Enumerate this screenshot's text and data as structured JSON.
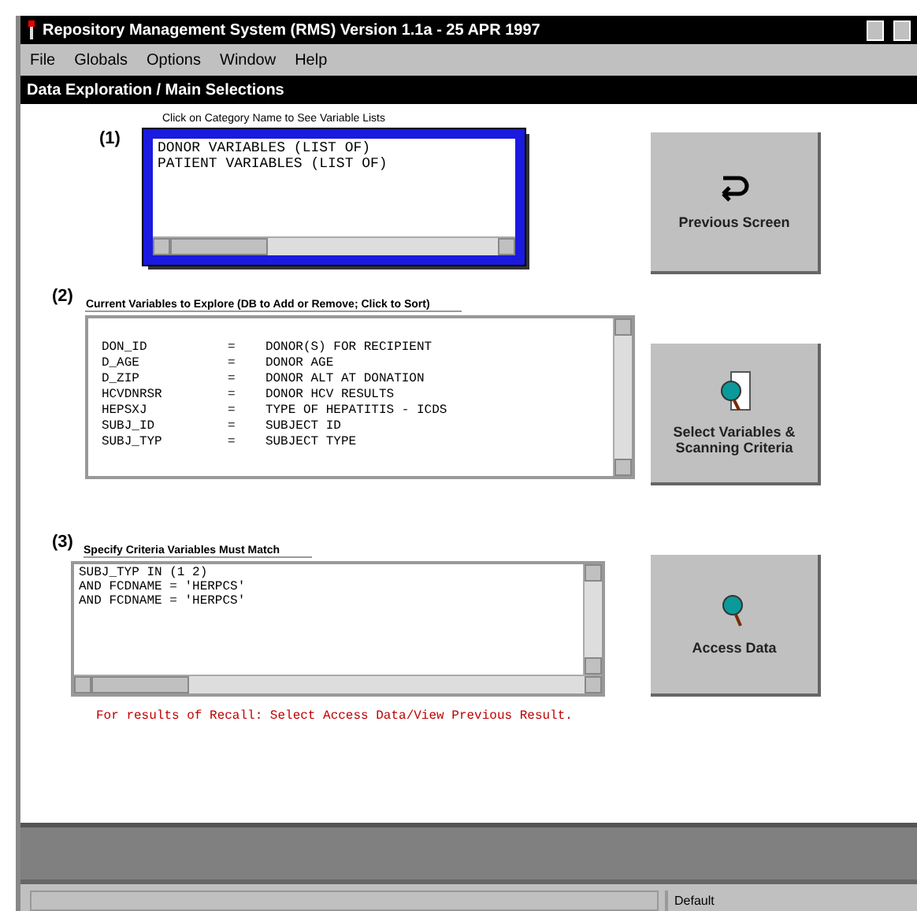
{
  "window": {
    "title": "Repository Management System (RMS) Version 1.1a - 25 APR 1997"
  },
  "menu": [
    "File",
    "Globals",
    "Options",
    "Window",
    "Help"
  ],
  "screen_title": "Data Exploration / Main Selections",
  "categories": {
    "hint": "Click on Category Name to See Variable Lists",
    "marker": "(1)",
    "items": [
      "DONOR VARIABLES (LIST OF)",
      "PATIENT VARIABLES (LIST OF)"
    ]
  },
  "variables": {
    "marker": "(2)",
    "label": "Current Variables to Explore (DB to Add or Remove; Click to Sort)",
    "rows": [
      {
        "name": "DON_ID",
        "sep": "=",
        "description": "DONOR(S) FOR RECIPIENT"
      },
      {
        "name": "D_AGE",
        "sep": "=",
        "description": "DONOR AGE"
      },
      {
        "name": "D_ZIP",
        "sep": "=",
        "description": "DONOR ALT AT DONATION"
      },
      {
        "name": "HCVDNRSR",
        "sep": "=",
        "description": "DONOR HCV RESULTS"
      },
      {
        "name": "HEPSXJ",
        "sep": "=",
        "description": "TYPE OF HEPATITIS - ICDS"
      },
      {
        "name": "SUBJ_ID",
        "sep": "=",
        "description": "SUBJECT ID"
      },
      {
        "name": "SUBJ_TYP",
        "sep": "=",
        "description": "SUBJECT TYPE"
      }
    ]
  },
  "criteria": {
    "marker": "(3)",
    "label": "Specify Criteria Variables Must Match",
    "lines": [
      "SUBJ_TYP IN (1 2)",
      "AND FCDNAME = 'HERPCS'",
      "AND FCDNAME = 'HERPCS'"
    ]
  },
  "message": "For results of Recall: Select Access Data/View Previous Result.",
  "buttons": [
    {
      "kind": "back",
      "label": "Previous Screen"
    },
    {
      "kind": "select",
      "label": "Select Variables & Scanning Criteria"
    },
    {
      "kind": "access",
      "label": "Access Data"
    }
  ],
  "status_bar": {
    "panel": "Default"
  }
}
